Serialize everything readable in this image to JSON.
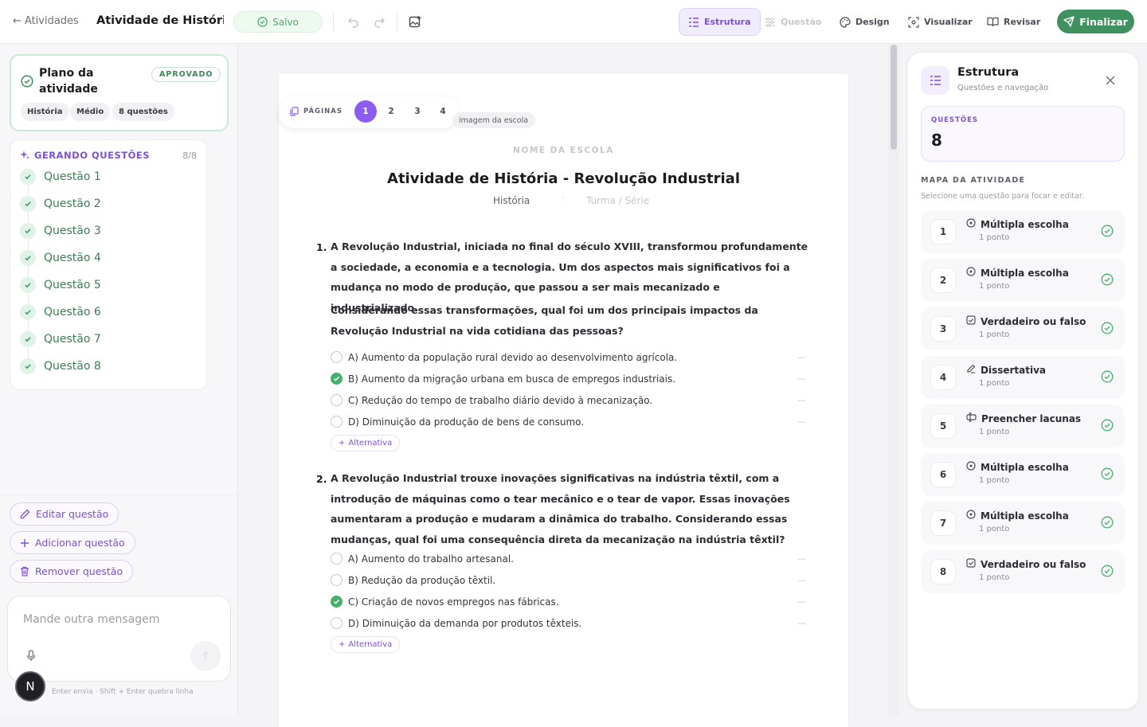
{
  "topbar": {
    "back_label": "Atividades",
    "title": "Atividade de Históri...",
    "saved_label": "Salvo",
    "nav": [
      {
        "label": "Estrutura",
        "state": "active"
      },
      {
        "label": "Questão",
        "state": "disabled"
      },
      {
        "label": "Design",
        "state": "normal"
      },
      {
        "label": "Visualizar",
        "state": "normal"
      },
      {
        "label": "Revisar",
        "state": "normal"
      }
    ],
    "finalize_label": "Finalizar"
  },
  "plan": {
    "title": "Plano da atividade",
    "badge": "APROVADO",
    "chips": [
      "História",
      "Médio",
      "8 questões"
    ]
  },
  "generation": {
    "heading": "GERANDO QUESTÕES",
    "count": "8/8",
    "items": [
      "Questão 1",
      "Questão 2",
      "Questão 3",
      "Questão 4",
      "Questão 5",
      "Questão 6",
      "Questão 7",
      "Questão 8"
    ]
  },
  "actions": {
    "edit": "Editar questão",
    "add": "Adicionar questão",
    "remove": "Remover questão"
  },
  "chat": {
    "placeholder": "Mande outra mensagem",
    "hint": "Enter envia · Shift + Enter quebra linha",
    "avatar_letter": "N"
  },
  "document": {
    "pager_label": "PÁGINAS",
    "pages": [
      "1",
      "2",
      "3",
      "4"
    ],
    "active_page": "1",
    "logo_chip": "imagem da escola",
    "school_placeholder": "NOME DA ESCOLA",
    "title": "Atividade de História - Revolução Industrial",
    "subject": "História",
    "separator": "·",
    "class_placeholder": "Turma / Série",
    "add_alternative": "Alternativa",
    "questions": [
      {
        "number": "1.",
        "text": "A Revolução Industrial, iniciada no final do século XVIII, transformou profundamente a sociedade, a economia e a tecnologia. Um dos aspectos mais significativos foi a mudança no modo de produção, que passou a ser mais mecanizado e industrializado.",
        "text2": "Considerando essas transformações, qual foi um dos principais impactos da Revolução Industrial na vida cotidiana das pessoas?",
        "options": [
          {
            "letter": "A)",
            "text": "Aumento da população rural devido ao desenvolvimento agrícola.",
            "correct": false
          },
          {
            "letter": "B)",
            "text": "Aumento da migração urbana em busca de empregos industriais.",
            "correct": true
          },
          {
            "letter": "C)",
            "text": "Redução do tempo de trabalho diário devido à mecanização.",
            "correct": false
          },
          {
            "letter": "D)",
            "text": "Diminuição da produção de bens de consumo.",
            "correct": false
          }
        ]
      },
      {
        "number": "2.",
        "text": "A Revolução Industrial trouxe inovações significativas na indústria têxtil, com a introdução de máquinas como o tear mecânico e o tear de vapor. Essas inovações aumentaram a produção e mudaram a dinâmica do trabalho. Considerando essas mudanças, qual foi uma consequência direta da mecanização na indústria têxtil?",
        "options": [
          {
            "letter": "A)",
            "text": "Aumento do trabalho artesanal.",
            "correct": false
          },
          {
            "letter": "B)",
            "text": "Redução da produção têxtil.",
            "correct": false
          },
          {
            "letter": "C)",
            "text": "Criação de novos empregos nas fábricas.",
            "correct": true
          },
          {
            "letter": "D)",
            "text": "Diminuição da demanda por produtos têxteis.",
            "correct": false
          }
        ]
      }
    ]
  },
  "structure": {
    "title": "Estrutura",
    "subtitle": "Questões e navegação",
    "questions_label": "QUESTÕES",
    "questions_count": "8",
    "map_label": "MAPA DA ATIVIDADE",
    "map_sub": "Selecione uma questão para focar e editar.",
    "items": [
      {
        "num": "1",
        "type": "Múltipla escolha",
        "icon": "radio-icon",
        "points": "1 ponto"
      },
      {
        "num": "2",
        "type": "Múltipla escolha",
        "icon": "radio-icon",
        "points": "1 ponto"
      },
      {
        "num": "3",
        "type": "Verdadeiro ou falso",
        "icon": "checkbox-icon",
        "points": "1 ponto"
      },
      {
        "num": "4",
        "type": "Dissertativa",
        "icon": "pencil-icon",
        "points": "1 ponto"
      },
      {
        "num": "5",
        "type": "Preencher lacunas",
        "icon": "text-cursor-icon",
        "points": "1 ponto"
      },
      {
        "num": "6",
        "type": "Múltipla escolha",
        "icon": "radio-icon",
        "points": "1 ponto"
      },
      {
        "num": "7",
        "type": "Múltipla escolha",
        "icon": "radio-icon",
        "points": "1 ponto"
      },
      {
        "num": "8",
        "type": "Verdadeiro ou falso",
        "icon": "checkbox-icon",
        "points": "1 ponto"
      }
    ]
  },
  "colors": {
    "accent_purple": "#7c4fe0",
    "accent_green": "#3f9160",
    "correct_green": "#44b06b"
  }
}
